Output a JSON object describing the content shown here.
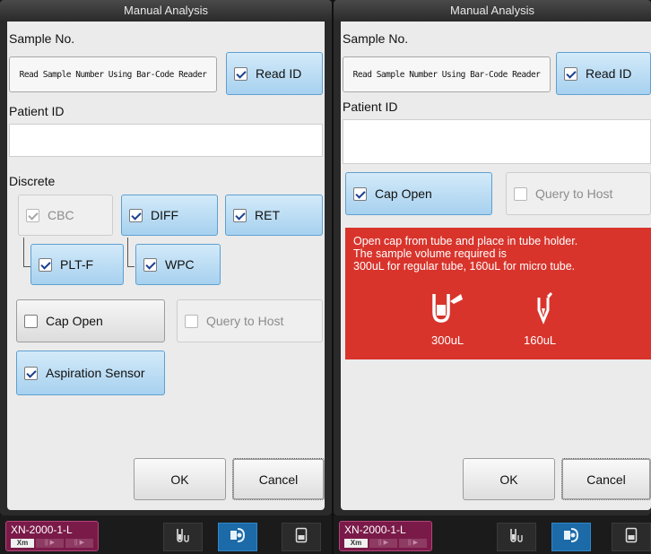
{
  "left": {
    "title": "Manual Analysis",
    "sample_no_label": "Sample No.",
    "barcode_label": "Read Sample Number Using Bar-Code Reader",
    "read_id_label": "Read ID",
    "patient_id_label": "Patient ID",
    "patient_id_value": "",
    "discrete_label": "Discrete",
    "discrete": {
      "cbc": "CBC",
      "diff": "DIFF",
      "ret": "RET",
      "plt_f": "PLT-F",
      "wpc": "WPC"
    },
    "cap_open_label": "Cap Open",
    "query_to_host_label": "Query to Host",
    "aspiration_sensor_label": "Aspiration Sensor",
    "ok_label": "OK",
    "cancel_label": "Cancel"
  },
  "right": {
    "title": "Manual Analysis",
    "sample_no_label": "Sample No.",
    "barcode_label": "Read Sample Number Using Bar-Code Reader",
    "read_id_label": "Read ID",
    "patient_id_label": "Patient ID",
    "patient_id_value": "",
    "cap_open_label": "Cap Open",
    "query_to_host_label": "Query to Host",
    "alert_text": "Open cap from tube and place in tube holder.\nThe sample volume required is\n300uL for regular tube, 160uL for micro tube.",
    "regular_volume": "300uL",
    "micro_volume": "160uL",
    "ok_label": "OK",
    "cancel_label": "Cancel"
  },
  "taskbar": {
    "analyzer_name": "XN-2000-1-L",
    "analyzer_badge": "Xm",
    "segments": [
      "|| ▶",
      "|| ▶"
    ]
  },
  "colors": {
    "alert": "#d8342c",
    "selected_button": "#a7d1ef",
    "analyzer": "#7a1a48",
    "active_tab": "#1c6aa8"
  },
  "checked": {
    "left_read_id": true,
    "left_cbc": true,
    "left_diff": true,
    "left_ret": true,
    "left_plt_f": true,
    "left_wpc": true,
    "left_cap_open": false,
    "left_query_to_host": false,
    "left_aspiration_sensor": true,
    "right_read_id": true,
    "right_cap_open": true,
    "right_query_to_host": false
  },
  "icons": {
    "taskbar_buttons": [
      "tube-rack-icon",
      "analysis-icon",
      "sample-card-icon"
    ]
  }
}
